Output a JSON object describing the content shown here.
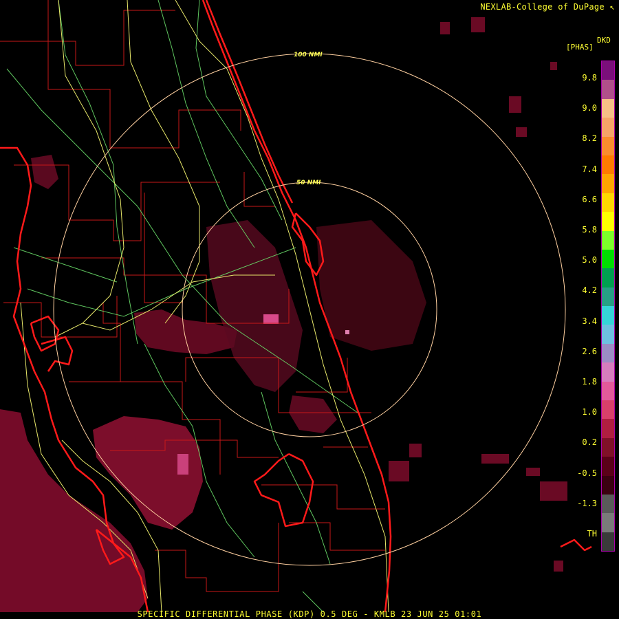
{
  "header": {
    "credit": "NEXLAB-College of DuPage",
    "credit_mark": "↖"
  },
  "product": {
    "code": "DKD",
    "units": "[PHAS]"
  },
  "footer": {
    "caption": "SPECIFIC DIFFERENTIAL PHASE (KDP) 0.5 DEG - KMLB 23 JUN 25 01:01"
  },
  "range_rings": {
    "inner": "50 NMI",
    "outer": "100 NMI"
  },
  "legend": {
    "labels": [
      "9.8",
      "9.0",
      "8.2",
      "7.4",
      "6.6",
      "5.8",
      "5.0",
      "4.2",
      "3.4",
      "2.6",
      "1.8",
      "1.0",
      "0.2",
      "-0.5",
      "-1.3",
      "TH"
    ],
    "colors": [
      "#7a0f7a",
      "#b0508a",
      "#f7bf86",
      "#f6a468",
      "#fa8c2e",
      "#ff7a00",
      "#ffa500",
      "#ffd700",
      "#ffff00",
      "#7dff2a",
      "#00dd00",
      "#00a050",
      "#27a085",
      "#36d4d8",
      "#6ec0e0",
      "#9c8cc4",
      "#d67dbd",
      "#e25a9a",
      "#d8406a",
      "#b01e40",
      "#801028",
      "#5a0018",
      "#3a0010",
      "#5a5a5a",
      "#7a7a7a",
      "#3a3a3a"
    ]
  },
  "map_colors": {
    "coast": "#ff1a1a",
    "county": "#c81818",
    "highway": "#e8e86a",
    "road": "#6adc6a",
    "ring": "#ffd0a0",
    "echo_dark": "#6a0a24",
    "echo": "#8a1030",
    "echo_light": "#d84a8a"
  }
}
